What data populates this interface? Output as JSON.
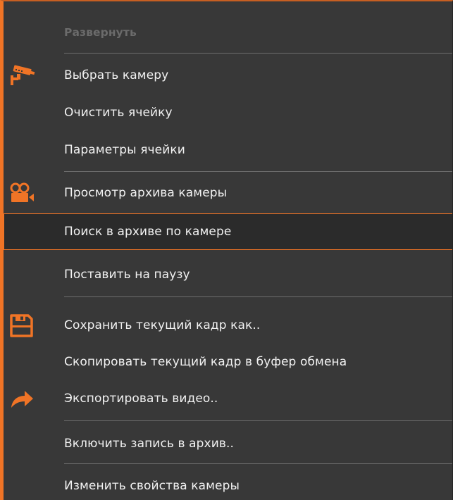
{
  "menu": {
    "expand_label": "Развернуть",
    "items": [
      {
        "label": "Выбрать камеру",
        "icon": "security-camera-icon"
      },
      {
        "label": "Очистить ячейку"
      },
      {
        "label": "Параметры ячейки"
      },
      {
        "label": "Просмотр архива камеры",
        "icon": "video-camera-icon"
      },
      {
        "label": "Поиск в архиве по камере",
        "state": "highlighted"
      },
      {
        "label": "Поставить на паузу"
      },
      {
        "label": "Сохранить текущий кадр как..",
        "icon": "save-icon"
      },
      {
        "label": "Скопировать текущий кадр в буфер обмена"
      },
      {
        "label": "Экспортировать видео..",
        "icon": "export-arrow-icon"
      },
      {
        "label": "Включить запись в архив.."
      },
      {
        "label": "Изменить свойства камеры"
      }
    ]
  },
  "colors": {
    "accent": "#f07426",
    "menu_background": "#383838",
    "highlight_background": "#2b2b2b",
    "text": "#f2f2f2",
    "disabled_text": "#6b6b6b",
    "separator": "#6d6d6d"
  }
}
